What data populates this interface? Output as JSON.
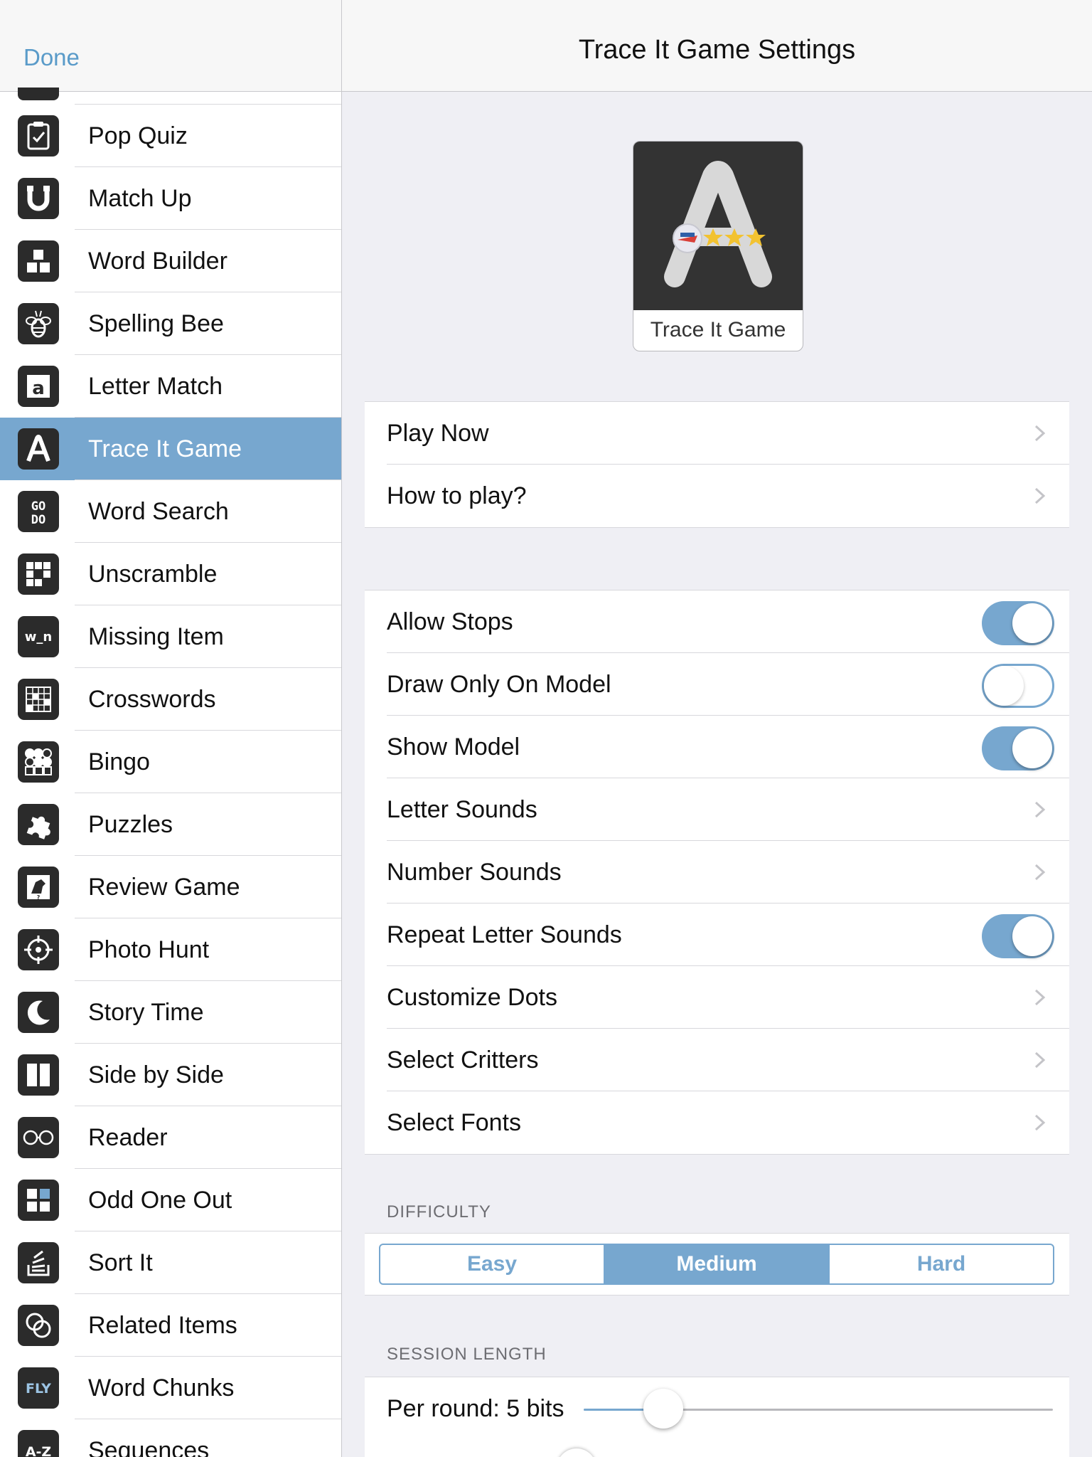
{
  "sidebar": {
    "done_label": "Done",
    "active_index": 5,
    "items": [
      {
        "label": "Pop Quiz",
        "icon": "clipboard-check-icon"
      },
      {
        "label": "Match Up",
        "icon": "magnet-icon"
      },
      {
        "label": "Word Builder",
        "icon": "blocks-icon"
      },
      {
        "label": "Spelling Bee",
        "icon": "bee-icon"
      },
      {
        "label": "Letter Match",
        "icon": "letter-a-stamp-icon"
      },
      {
        "label": "Trace It Game",
        "icon": "trace-a-icon"
      },
      {
        "label": "Word Search",
        "icon": "go-do-grid-icon"
      },
      {
        "label": "Unscramble",
        "icon": "grid-tiles-icon"
      },
      {
        "label": "Missing Item",
        "icon": "w-blank-n-icon"
      },
      {
        "label": "Crosswords",
        "icon": "crossword-grid-icon"
      },
      {
        "label": "Bingo",
        "icon": "bingo-dots-icon"
      },
      {
        "label": "Puzzles",
        "icon": "puzzle-piece-icon"
      },
      {
        "label": "Review Game",
        "icon": "dog-card-icon"
      },
      {
        "label": "Photo Hunt",
        "icon": "crosshair-icon"
      },
      {
        "label": "Story Time",
        "icon": "moon-icon"
      },
      {
        "label": "Side by Side",
        "icon": "two-columns-icon"
      },
      {
        "label": "Reader",
        "icon": "glasses-icon"
      },
      {
        "label": "Odd One Out",
        "icon": "four-squares-icon"
      },
      {
        "label": "Sort It",
        "icon": "stack-sort-icon"
      },
      {
        "label": "Related Items",
        "icon": "linked-circles-icon"
      },
      {
        "label": "Word Chunks",
        "icon": "fly-text-icon"
      },
      {
        "label": "Sequences",
        "icon": "a-z-icon"
      }
    ],
    "icon_glyphs": {
      "go_do": "GO\nDO",
      "w_n": "w_n",
      "fly": "FLY",
      "a_z": "A-Z",
      "a_letter": "a",
      "trace_letter": "A"
    }
  },
  "header": {
    "title": "Trace It Game Settings"
  },
  "game_tile": {
    "caption": "Trace It Game",
    "art_letter": "A"
  },
  "actions": [
    {
      "label": "Play Now"
    },
    {
      "label": "How to play?"
    }
  ],
  "options": [
    {
      "label": "Allow Stops",
      "type": "toggle",
      "on": true
    },
    {
      "label": "Draw Only On Model",
      "type": "toggle",
      "on": false
    },
    {
      "label": "Show Model",
      "type": "toggle",
      "on": true
    },
    {
      "label": "Letter Sounds",
      "type": "link"
    },
    {
      "label": "Number Sounds",
      "type": "link"
    },
    {
      "label": "Repeat Letter Sounds",
      "type": "toggle",
      "on": true
    },
    {
      "label": "Customize Dots",
      "type": "link"
    },
    {
      "label": "Select Critters",
      "type": "link"
    },
    {
      "label": "Select Fonts",
      "type": "link"
    }
  ],
  "difficulty": {
    "section_label": "DIFFICULTY",
    "options": [
      "Easy",
      "Medium",
      "Hard"
    ],
    "selected": "Medium"
  },
  "session_length": {
    "section_label": "SESSION LENGTH",
    "label": "Per round: 5 bits",
    "slider_fraction": 0.17
  },
  "colors": {
    "accent": "#77a7cf",
    "done_link": "#5a9bc9",
    "icon_bg": "#2b2b2b",
    "grouped_bg": "#efeff4"
  }
}
